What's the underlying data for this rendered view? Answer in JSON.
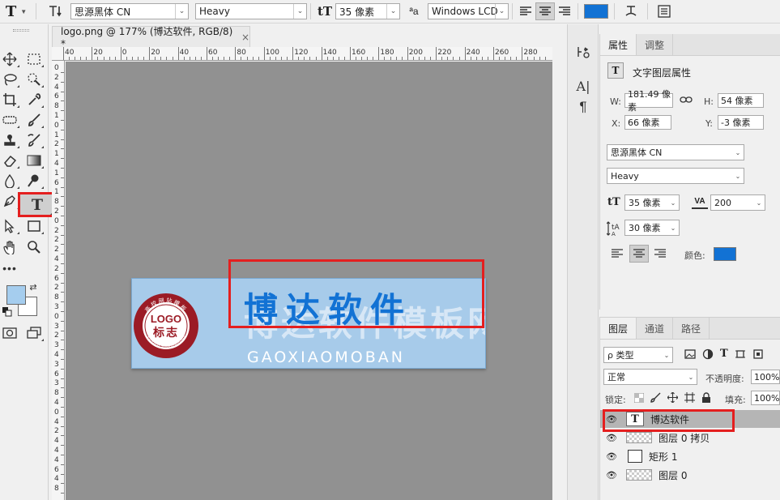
{
  "options_bar": {
    "tool_icon": "T",
    "orientation_icon": "text-orientation-icon",
    "font_family": "思源黑体 CN",
    "font_style": "Heavy",
    "size_icon": "tT",
    "font_size": "35 像素",
    "aa_label": "ªa",
    "antialias": "Windows LCD",
    "color": "#1272d4"
  },
  "document": {
    "tab_title": "logo.png @ 177% (博达软件, RGB/8) *",
    "close": "×",
    "ruler_top": [
      "40",
      "20",
      "0",
      "20",
      "40",
      "60",
      "80",
      "100",
      "120",
      "140",
      "160",
      "180",
      "200",
      "220",
      "240",
      "260",
      "280"
    ],
    "ruler_left": [
      "0",
      "2",
      "4",
      "6",
      "8",
      "1",
      "0",
      "1",
      "2",
      "1",
      "4",
      "1",
      "6",
      "1",
      "8",
      "2",
      "0",
      "2",
      "2",
      "2",
      "4",
      "2",
      "6",
      "2",
      "8",
      "3",
      "0",
      "3",
      "2",
      "3",
      "4",
      "3",
      "6",
      "3",
      "8",
      "4",
      "0",
      "4",
      "2",
      "4",
      "4",
      "4",
      "6",
      "4",
      "8"
    ],
    "logo": {
      "seal_top": "高校网站模板",
      "seal_logo": "LOGO",
      "seal_cn": "标志",
      "seal_bottom": "Xiaomi SiteBuilder",
      "ghost_text": "博达软件模板网",
      "brand": "博达软件",
      "slogan": "GAOXIAOMOBAN"
    }
  },
  "properties": {
    "tabs": [
      "属性",
      "调整"
    ],
    "header_icon": "T",
    "header_label": "文字图层属性",
    "w_label": "W:",
    "w_value": "181.49 像素",
    "h_label": "H:",
    "h_value": "54 像素",
    "x_label": "X:",
    "x_value": "66 像素",
    "y_label": "Y:",
    "y_value": "-3 像素",
    "font_family": "思源黑体 CN",
    "font_style": "Heavy",
    "font_size": "35 像素",
    "tracking_icon": "VA",
    "tracking": "200",
    "leading": "30 像素",
    "color_label": "颜色:",
    "color": "#1272d4"
  },
  "layers": {
    "tabs": [
      "图层",
      "通道",
      "路径"
    ],
    "filter_label": "ρ 类型",
    "blend_mode": "正常",
    "opacity_label": "不透明度:",
    "opacity": "100%",
    "lock_label": "锁定:",
    "fill_label": "填充:",
    "fill": "100%",
    "items": [
      {
        "name": "博达软件",
        "type": "text",
        "selected": true
      },
      {
        "name": "图层 0 拷贝",
        "type": "pixel",
        "selected": false
      },
      {
        "name": "矩形 1",
        "type": "shape",
        "selected": false
      },
      {
        "name": "图层 0",
        "type": "pixel",
        "selected": false
      }
    ]
  }
}
